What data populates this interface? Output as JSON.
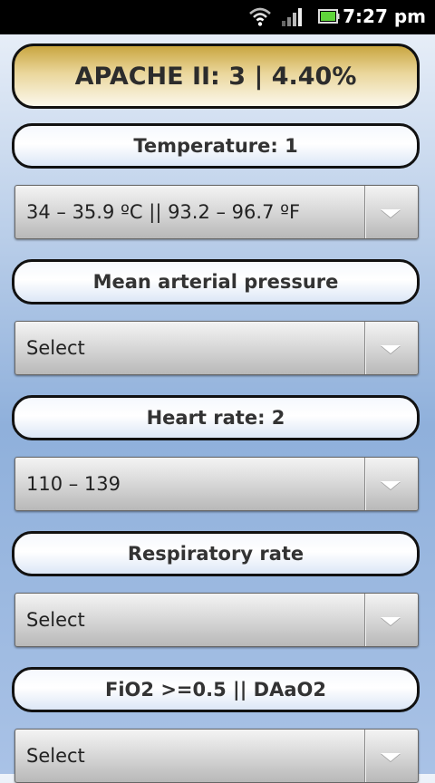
{
  "status_bar": {
    "time": "7:27 pm"
  },
  "summary": {
    "text": "APACHE II: 3 | 4.40%"
  },
  "fields": [
    {
      "label": "Temperature: 1",
      "value": "34 – 35.9 ºC || 93.2 – 96.7 ºF"
    },
    {
      "label": "Mean arterial pressure",
      "value": "Select"
    },
    {
      "label": "Heart rate: 2",
      "value": "110 – 139"
    },
    {
      "label": "Respiratory rate",
      "value": "Select"
    },
    {
      "label": "FiO2 >=0.5 || DAaO2",
      "value": "Select"
    }
  ]
}
